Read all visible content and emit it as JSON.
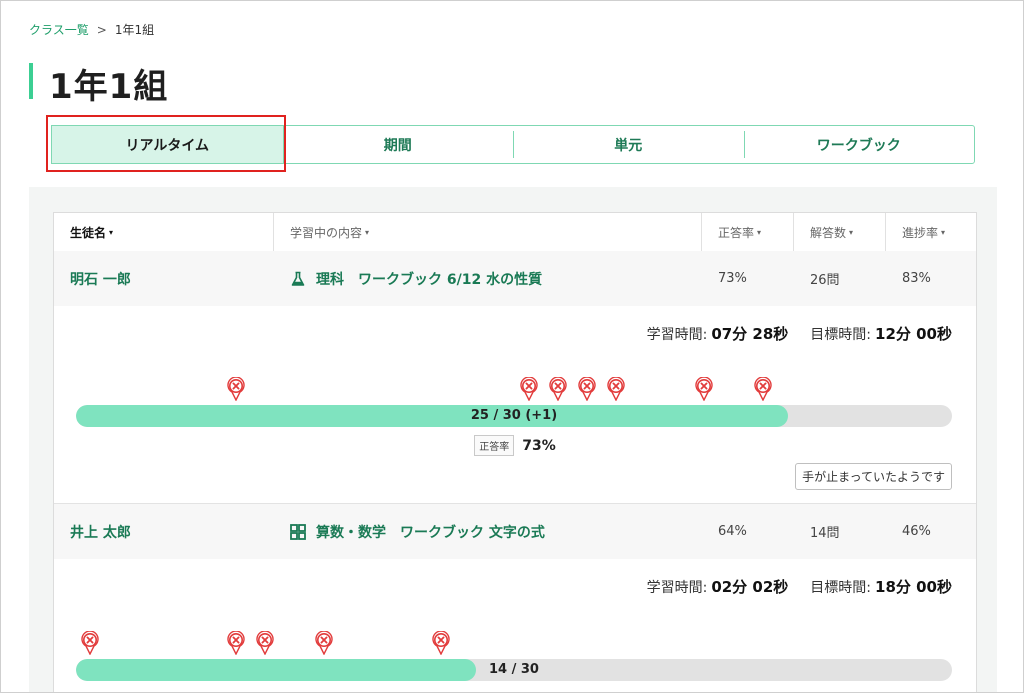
{
  "breadcrumb": {
    "link": "クラス一覧",
    "separator": ">",
    "current": "1年1組"
  },
  "page_title": "1年1組",
  "tabs": [
    {
      "label": "リアルタイム",
      "active": true
    },
    {
      "label": "期間",
      "active": false
    },
    {
      "label": "単元",
      "active": false
    },
    {
      "label": "ワークブック",
      "active": false
    }
  ],
  "table": {
    "headers": {
      "name": "生徒名",
      "content": "学習中の内容",
      "accuracy": "正答率",
      "answers": "解答数",
      "progress": "進捗率"
    },
    "caret": "▾"
  },
  "students": [
    {
      "name": "明石 一郎",
      "icon": "flask-icon",
      "content": "理科　ワークブック 6/12 水の性質",
      "accuracy": "73%",
      "answers": "26問",
      "progress": "83%",
      "study_time_label": "学習時間:",
      "study_time": "07分 28秒",
      "target_time_label": "目標時間:",
      "target_time": "12分 00秒",
      "bar_label": "25 / 30 (+1)",
      "bar_fraction": 0.8133,
      "wrong_markers": [
        5,
        15,
        16,
        17,
        18,
        21,
        23
      ],
      "accuracy_tag": "正答率",
      "accuracy_value": "73%",
      "stuck_label": "手が止まっていたようです"
    },
    {
      "name": "井上 太郎",
      "icon": "grid-icon",
      "content": "算数・数学　ワークブック 文字の式",
      "accuracy": "64%",
      "answers": "14問",
      "progress": "46%",
      "study_time_label": "学習時間:",
      "study_time": "02分 02秒",
      "target_time_label": "目標時間:",
      "target_time": "18分 00秒",
      "bar_label": "14 / 30",
      "bar_fraction": 0.4567,
      "wrong_markers": [
        0,
        5,
        6,
        8,
        12
      ]
    }
  ],
  "colors": {
    "accent": "#3ccf93",
    "bar_fill": "#7fe3bf",
    "link_green": "#1a7a55",
    "wrong_marker": "#e23c3c",
    "highlight_box": "#e0221f"
  }
}
